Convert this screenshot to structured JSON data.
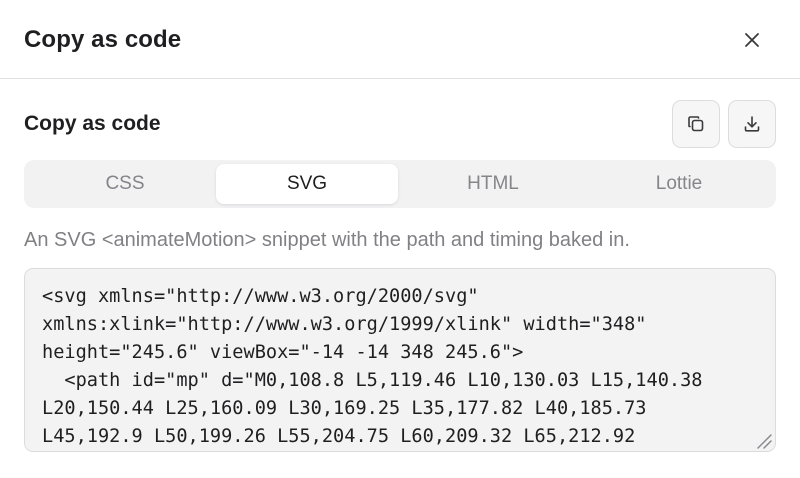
{
  "header": {
    "title": "Copy as code"
  },
  "section": {
    "title": "Copy as code",
    "copy_icon": "copy-icon",
    "download_icon": "download-icon"
  },
  "tabs": [
    {
      "label": "CSS",
      "active": false
    },
    {
      "label": "SVG",
      "active": true
    },
    {
      "label": "HTML",
      "active": false
    },
    {
      "label": "Lottie",
      "active": false
    }
  ],
  "description": "An SVG <animateMotion> snippet with the path and timing baked in.",
  "code": {
    "lines": [
      "<svg xmlns=\"http://www.w3.org/2000/svg\"",
      "xmlns:xlink=\"http://www.w3.org/1999/xlink\" width=\"348\"",
      "height=\"245.6\" viewBox=\"-14 -14 348 245.6\">",
      "  <path id=\"mp\" d=\"M0,108.8 L5,119.46 L10,130.03 L15,140.38",
      "L20,150.44 L25,160.09 L30,169.25 L35,177.82 L40,185.73",
      "L45,192.9 L50,199.26 L55,204.75 L60,209.32 L65,212.92"
    ]
  },
  "colors": {
    "tab_track": "#f2f2f3",
    "code_bg": "#f3f3f3",
    "muted_text": "#808085"
  }
}
